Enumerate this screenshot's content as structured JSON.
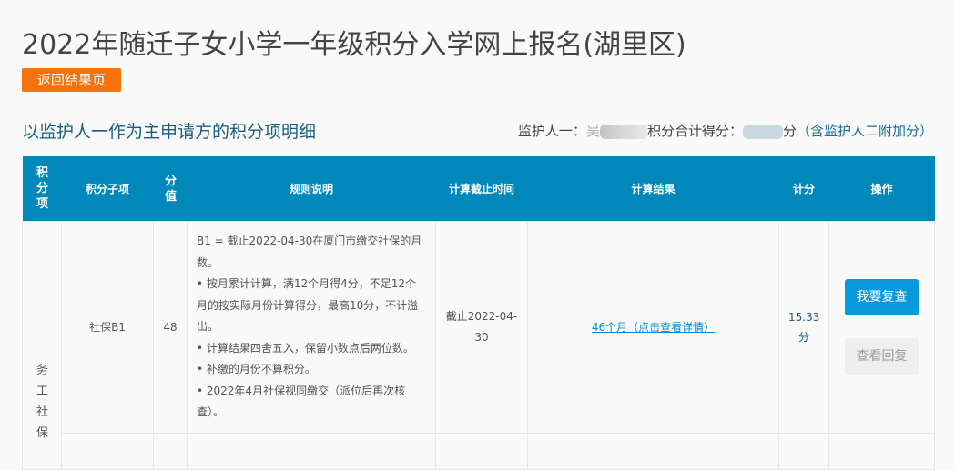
{
  "page": {
    "title": "2022年随迁子女小学一年级积分入学网上报名(湖里区)",
    "back_button": "返回结果页",
    "section_title": "以监护人一作为主申请方的积分项明细",
    "summary": {
      "guardian_label": "监护人一：",
      "guardian_initial": "吴",
      "total_label": "积分合计得分：",
      "unit": "分",
      "note": "（含监护人二附加分）"
    }
  },
  "table": {
    "headers": [
      "积分项",
      "积分子项",
      "分值",
      "规则说明",
      "计算截止时间",
      "计算结果",
      "计分",
      "操作"
    ],
    "rows": [
      {
        "category": "务工社保",
        "subitem": "社保B1",
        "value": "48",
        "rules": [
          "B1 = 截止2022-04-30在厦门市缴交社保的月数。",
          "• 按月累计计算，满12个月得4分，不足12个月的按实际月份计算得分，最高10分，不计溢出。",
          "• 计算结果四舍五入，保留小数点后两位数。",
          "• 补缴的月份不算积分。",
          "• 2022年4月社保视同缴交（派位后再次核查）。"
        ],
        "deadline": "截止2022-04-30",
        "result_link": "46个月（点击查看详情）",
        "score": "15.33分",
        "actions": {
          "review": "我要复查",
          "view_reply": "查看回复"
        }
      }
    ]
  },
  "colors": {
    "header": "#0088bb",
    "back": "#f7720b",
    "primary": "#0899dd"
  }
}
